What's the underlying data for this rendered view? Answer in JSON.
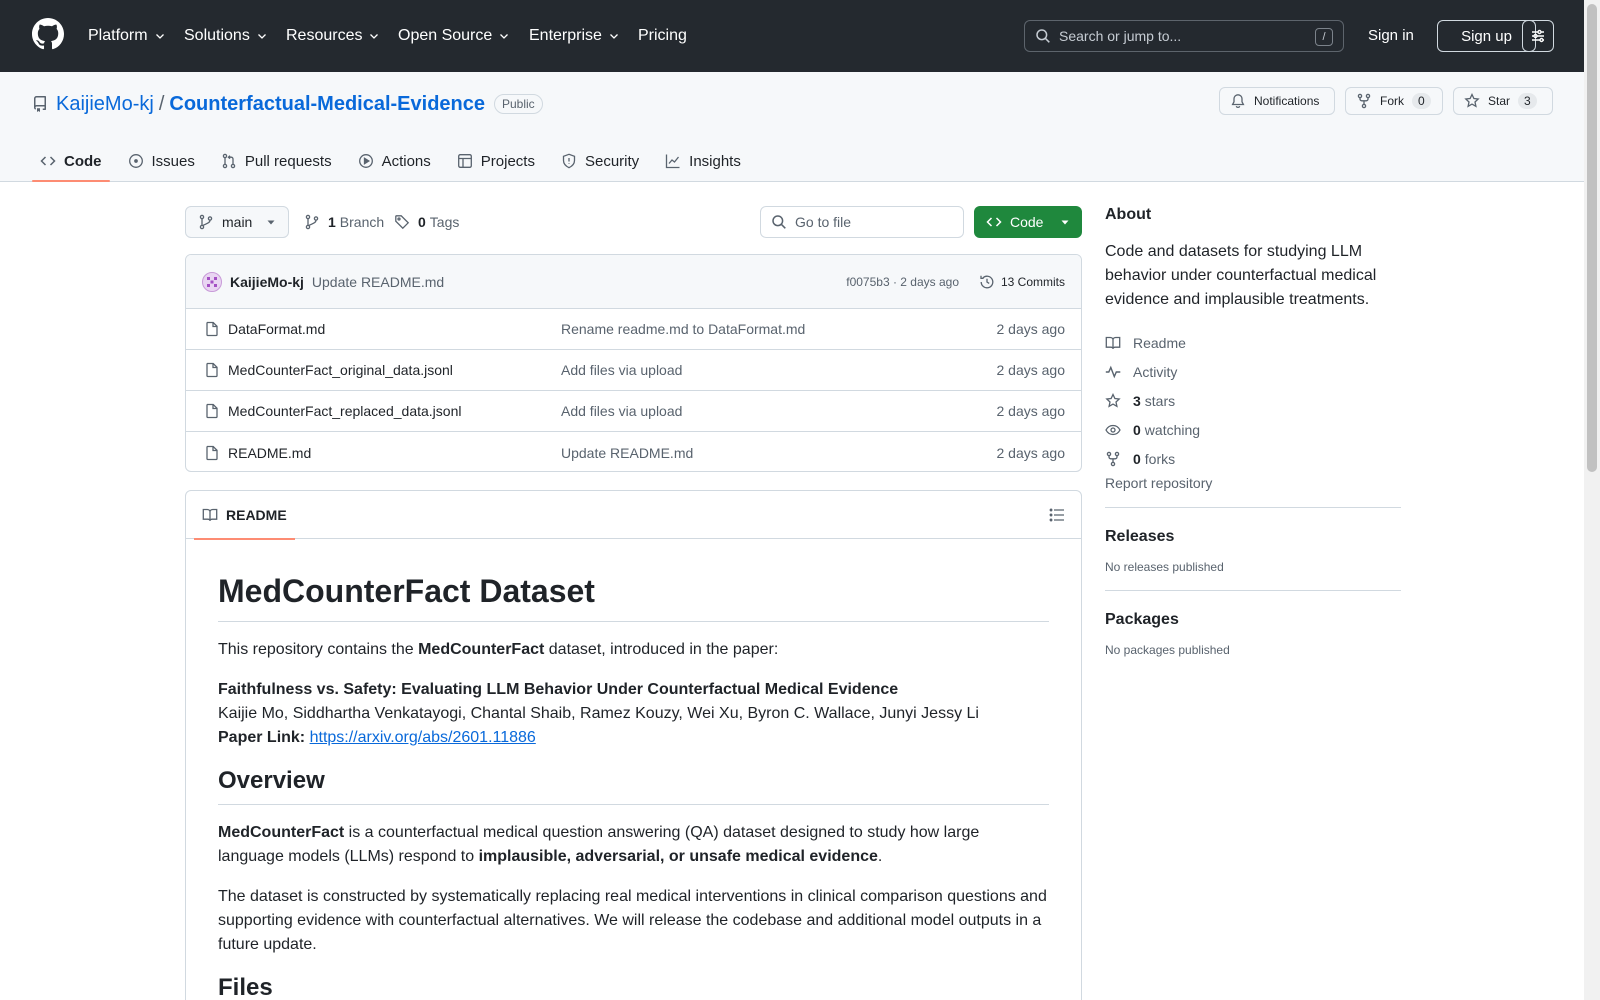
{
  "header": {
    "nav": [
      {
        "label": "Platform"
      },
      {
        "label": "Solutions"
      },
      {
        "label": "Resources"
      },
      {
        "label": "Open Source"
      },
      {
        "label": "Enterprise"
      },
      {
        "label": "Pricing"
      }
    ],
    "search_placeholder": "Search or jump to...",
    "search_shortcut": "/",
    "sign_in": "Sign in",
    "sign_up": "Sign up"
  },
  "repo": {
    "owner": "KaijieMo-kj",
    "separator": "/",
    "name": "Counterfactual-Medical-Evidence",
    "visibility": "Public",
    "notifications_label": "Notifications",
    "fork_label": "Fork",
    "fork_count": "0",
    "star_label": "Star",
    "star_count": "3",
    "tabs": [
      {
        "label": "Code",
        "icon": "code-icon"
      },
      {
        "label": "Issues",
        "icon": "issue-icon"
      },
      {
        "label": "Pull requests",
        "icon": "pull-request-icon"
      },
      {
        "label": "Actions",
        "icon": "play-icon"
      },
      {
        "label": "Projects",
        "icon": "table-icon"
      },
      {
        "label": "Security",
        "icon": "shield-icon"
      },
      {
        "label": "Insights",
        "icon": "graph-icon"
      }
    ]
  },
  "files": {
    "branch": "main",
    "branch_count": "1",
    "branch_label": "Branch",
    "tag_count": "0",
    "tag_label": "Tags",
    "goto_placeholder": "Go to file",
    "code_button": "Code",
    "latest_commit": {
      "author": "KaijieMo-kj",
      "message": "Update README.md",
      "hash_and_time": "f0075b3 · 2 days ago",
      "commits_label": "13 Commits"
    },
    "rows": [
      {
        "name": "DataFormat.md",
        "commit": "Rename readme.md to DataFormat.md",
        "date": "2 days ago"
      },
      {
        "name": "MedCounterFact_original_data.jsonl",
        "commit": "Add files via upload",
        "date": "2 days ago"
      },
      {
        "name": "MedCounterFact_replaced_data.jsonl",
        "commit": "Add files via upload",
        "date": "2 days ago"
      },
      {
        "name": "README.md",
        "commit": "Update README.md",
        "date": "2 days ago"
      }
    ]
  },
  "readme": {
    "tab_label": "README",
    "title": "MedCounterFact Dataset",
    "intro_prefix": "This repository contains the ",
    "intro_bold": "MedCounterFact",
    "intro_suffix": " dataset, introduced in the paper:",
    "paper_title": "Faithfulness vs. Safety: Evaluating LLM Behavior Under Counterfactual Medical Evidence",
    "authors": "Kaijie Mo, Siddhartha Venkatayogi, Chantal Shaib, Ramez Kouzy, Wei Xu, Byron C. Wallace, Junyi Jessy Li",
    "paper_link_label": "Paper Link:",
    "paper_link": "https://arxiv.org/abs/2601.11886",
    "overview_heading": "Overview",
    "overview_bold1": "MedCounterFact",
    "overview_text1": " is a counterfactual medical question answering (QA) dataset designed to study how large language models (LLMs) respond to ",
    "overview_bold2": "implausible, adversarial, or unsafe medical evidence",
    "overview_text2": ".",
    "overview_p2": "The dataset is constructed by systematically replacing real medical interventions in clinical comparison questions and supporting evidence with counterfactual alternatives. We will release the codebase and additional model outputs in a future update.",
    "files_heading": "Files"
  },
  "sidebar": {
    "about_heading": "About",
    "description": "Code and datasets for studying LLM behavior under counterfactual medical evidence and implausible treatments.",
    "readme_link": "Readme",
    "activity_link": "Activity",
    "stars_count": "3",
    "stars_label": "stars",
    "watching_count": "0",
    "watching_label": "watching",
    "forks_count": "0",
    "forks_label": "forks",
    "report": "Report repository",
    "releases_heading": "Releases",
    "releases_note": "No releases published",
    "packages_heading": "Packages",
    "packages_note": "No packages published"
  },
  "colors": {
    "header_bg": "#24292f",
    "link": "#0969da",
    "primary_button": "#1f883d",
    "active_tab_underline": "#fd8c73"
  }
}
